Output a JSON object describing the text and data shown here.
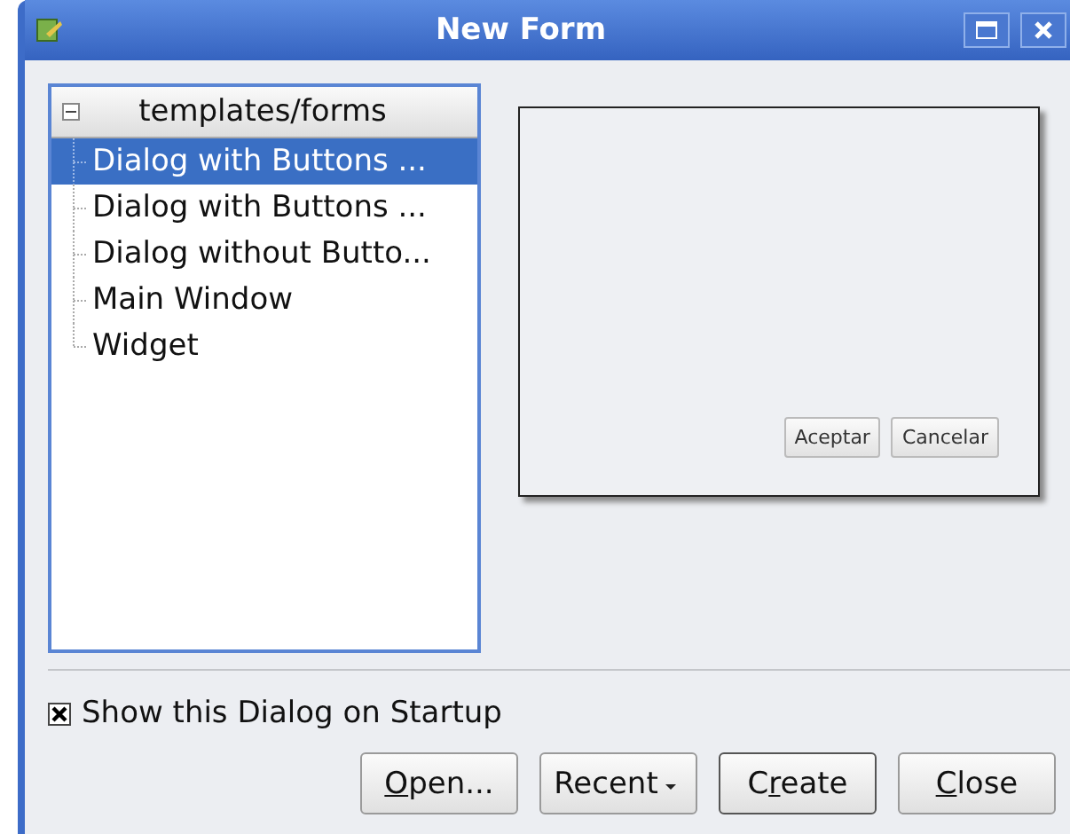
{
  "window": {
    "title": "New Form"
  },
  "tree": {
    "header": "templates/forms",
    "expanded": true,
    "items": [
      {
        "label": "Dialog with Buttons ...",
        "selected": true
      },
      {
        "label": "Dialog with Buttons ...",
        "selected": false
      },
      {
        "label": "Dialog without Butto...",
        "selected": false
      },
      {
        "label": "Main Window",
        "selected": false
      },
      {
        "label": "Widget",
        "selected": false
      }
    ]
  },
  "preview": {
    "buttons": [
      "Aceptar",
      "Cancelar"
    ]
  },
  "startup_checkbox": {
    "label": "Show this Dialog on Startup",
    "checked": true
  },
  "buttons": [
    {
      "kind": "plain",
      "mnemonic": "O",
      "after": "pen...",
      "default": false
    },
    {
      "kind": "menu",
      "before": "Recent",
      "default": false
    },
    {
      "kind": "plain",
      "before": "C",
      "mnemonic": "r",
      "after": "eate",
      "default": true
    },
    {
      "kind": "plain",
      "mnemonic": "C",
      "after": "lose",
      "default": false
    }
  ]
}
